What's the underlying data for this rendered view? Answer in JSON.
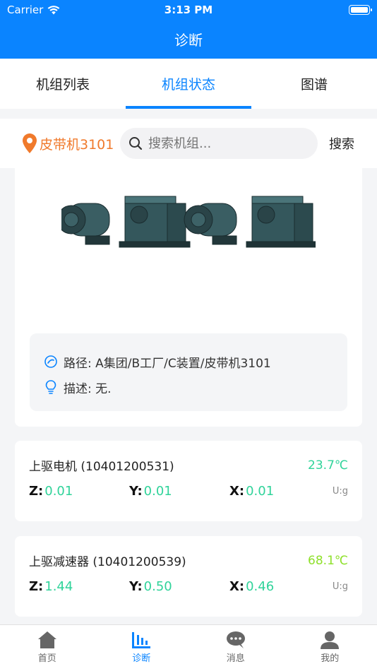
{
  "status": {
    "carrier": "Carrier",
    "time": "3:13 PM"
  },
  "nav": {
    "title": "诊断"
  },
  "tabs": [
    {
      "label": "机组列表"
    },
    {
      "label": "机组状态"
    },
    {
      "label": "图谱"
    }
  ],
  "search": {
    "location": "皮带机3101",
    "placeholder": "搜索机组...",
    "button": "搜索"
  },
  "machine": {
    "path_label": "路径: A集团/B工厂/C装置/皮带机3101",
    "desc_label": "描述: 无."
  },
  "sensors": [
    {
      "name": "上驱电机 (10401200531)",
      "temp": "23.7℃",
      "temp_color": "#30d39a",
      "z_key": "Z:",
      "z": "0.01",
      "y_key": "Y:",
      "y": "0.01",
      "x_key": "X:",
      "x": "0.01",
      "unit": "U:g"
    },
    {
      "name": "上驱减速器 (10401200539)",
      "temp": "68.1℃",
      "temp_color": "#8ee02a",
      "z_key": "Z:",
      "z": "1.44",
      "y_key": "Y:",
      "y": "0.50",
      "x_key": "X:",
      "x": "0.46",
      "unit": "U:g"
    }
  ],
  "tabbar": [
    {
      "label": "首页",
      "icon": "home-icon"
    },
    {
      "label": "诊断",
      "icon": "chart-icon"
    },
    {
      "label": "消息",
      "icon": "chat-icon"
    },
    {
      "label": "我的",
      "icon": "user-icon"
    }
  ],
  "colors": {
    "primary": "#0a84ff",
    "location": "#f07a2c",
    "value": "#30d39a"
  }
}
